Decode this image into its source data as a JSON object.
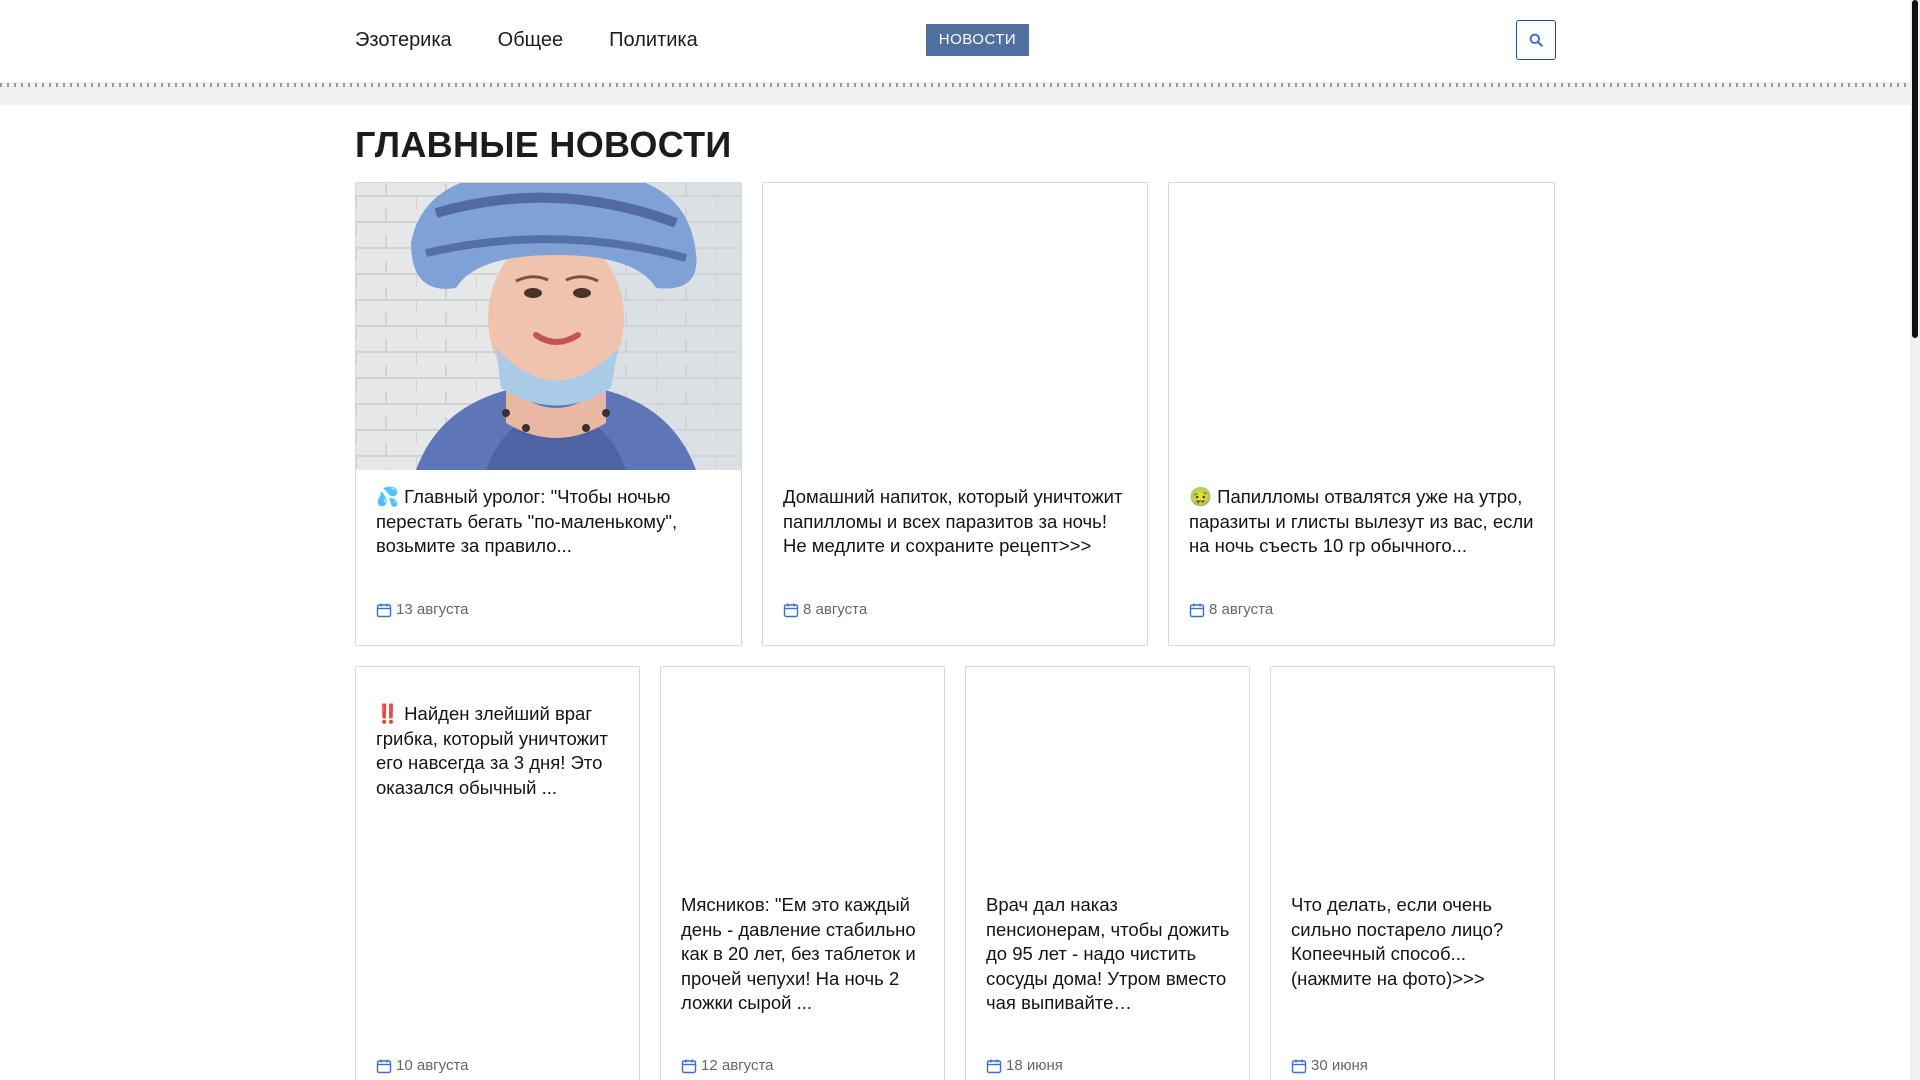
{
  "nav": {
    "items": [
      "Эзотерика",
      "Общее",
      "Политика"
    ],
    "news_button": "НОВОСТИ"
  },
  "section": {
    "title": "ГЛАВНЫЕ НОВОСТИ"
  },
  "cards": [
    {
      "title": "💦 Главный уролог: \"Чтобы ночью перестать бегать \"по-маленькому\", возьмите за правило...",
      "date": "13 августа"
    },
    {
      "title": "Домашний напиток, который уничтожит папилломы и всех паразитов за ночь! Не медлите и сохраните рецепт>>>",
      "date": "8 августа"
    },
    {
      "title": "🤢 Папилломы отвалятся уже на утро, паразиты и глисты вылезут из вас, если на ночь съесть 10 гр обычного...",
      "date": "8 августа"
    },
    {
      "title": "‼️ Найден злейший враг грибка, который уничтожит его навсегда за 3 дня! Это оказался обычный ...",
      "date": "10 августа"
    },
    {
      "title": "Мясников: \"Ем это каждый день - давление стабильно как в 20 лет, без таблеток и прочей чепухи! На ночь 2 ложки сырой ...",
      "date": "12 августа"
    },
    {
      "title": "Врач дал наказ пенсионерам, чтобы дожить до 95 лет - надо чистить сосуды дома! Утром вместо чая выпивайте…",
      "date": "18 июня"
    },
    {
      "title": "Что делать, если очень сильно постарело лицо? Копеечный способ... (нажмите на фото)>>>",
      "date": "30 июня"
    }
  ],
  "colors": {
    "accent": "#51709f",
    "icon_blue": "#3b6fd1"
  },
  "icons": {
    "search": "search-icon",
    "calendar": "calendar-icon"
  }
}
